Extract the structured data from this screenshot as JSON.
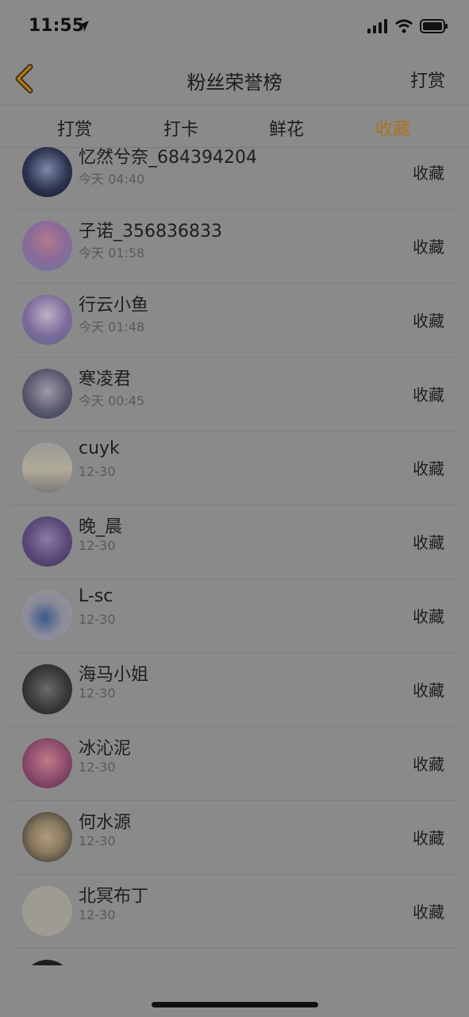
{
  "status": {
    "time": "11:55"
  },
  "nav": {
    "title": "粉丝荣誉榜",
    "right_action": "打赏"
  },
  "tabs": [
    {
      "label": "打赏"
    },
    {
      "label": "打卡"
    },
    {
      "label": "鲜花"
    },
    {
      "label": "收藏"
    }
  ],
  "active_tab": "收藏",
  "colors": {
    "accent": "#a8741e",
    "background": "#8a8a8a"
  },
  "list": [
    {
      "name": "忆然兮奈_684394204",
      "time": "今天 04:40",
      "action": "收藏"
    },
    {
      "name": "子诺_356836833",
      "time": "今天 01:58",
      "action": "收藏"
    },
    {
      "name": "行云小鱼",
      "time": "今天 01:48",
      "action": "收藏"
    },
    {
      "name": "寒凌君",
      "time": "今天 00:45",
      "action": "收藏"
    },
    {
      "name": " cuyk",
      "time": "12-30",
      "action": "收藏"
    },
    {
      "name": "晚_晨",
      "time": "12-30",
      "action": "收藏"
    },
    {
      "name": "L-sc",
      "time": "12-30",
      "action": "收藏"
    },
    {
      "name": "海马小姐",
      "time": "12-30",
      "action": "收藏"
    },
    {
      "name": "冰沁泥",
      "time": "12-30",
      "action": "收藏"
    },
    {
      "name": "何水源",
      "time": "12-30",
      "action": "收藏"
    },
    {
      "name": "北冥布丁",
      "time": "12-30",
      "action": "收藏"
    }
  ]
}
